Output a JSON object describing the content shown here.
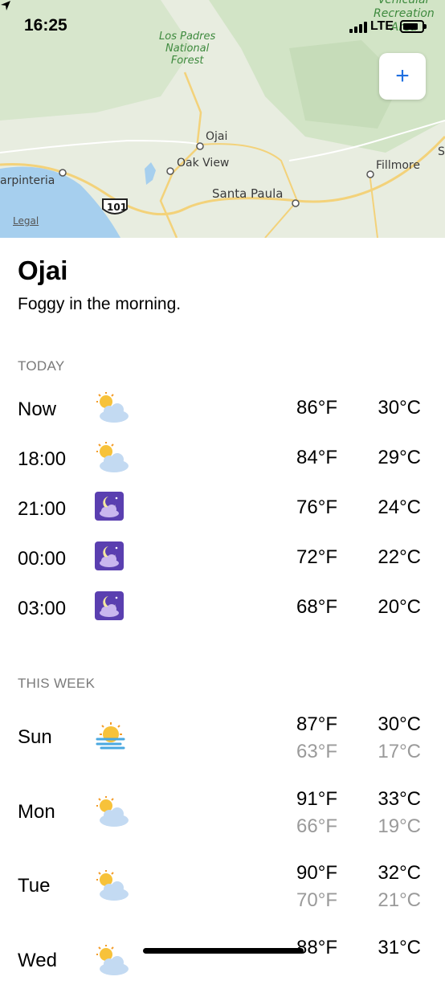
{
  "status_bar": {
    "time": "16:25",
    "network": "LTE",
    "location_icon": "location-arrow-icon"
  },
  "map": {
    "labels": {
      "forest": "Los Padres\nNational\nForest",
      "recreation": "Vehicular\nRecreation\nArea",
      "ojai": "Ojai",
      "oak_view": "Oak View",
      "santa_paula": "Santa Paula",
      "fillmore": "Fillmore",
      "carpinteria": "arpinteria",
      "highway": "101",
      "edge_letter": "S",
      "legal": "Legal"
    },
    "add_button_label": "+"
  },
  "location": {
    "name": "Ojai",
    "summary": "Foggy in the morning."
  },
  "today": {
    "header": "TODAY",
    "rows": [
      {
        "time": "Now",
        "icon": "partly-cloudy-icon",
        "temp_f": "86°F",
        "temp_c": "30°C"
      },
      {
        "time": "18:00",
        "icon": "partly-cloudy-icon",
        "temp_f": "84°F",
        "temp_c": "29°C"
      },
      {
        "time": "21:00",
        "icon": "night-cloud-icon",
        "temp_f": "76°F",
        "temp_c": "24°C"
      },
      {
        "time": "00:00",
        "icon": "night-cloud-icon",
        "temp_f": "72°F",
        "temp_c": "22°C"
      },
      {
        "time": "03:00",
        "icon": "night-cloud-icon",
        "temp_f": "68°F",
        "temp_c": "20°C"
      }
    ]
  },
  "week": {
    "header": "THIS WEEK",
    "rows": [
      {
        "day": "Sun",
        "icon": "sun-fog-icon",
        "high_f": "87°F",
        "low_f": "63°F",
        "high_c": "30°C",
        "low_c": "17°C"
      },
      {
        "day": "Mon",
        "icon": "partly-cloudy-icon",
        "high_f": "91°F",
        "low_f": "66°F",
        "high_c": "33°C",
        "low_c": "19°C"
      },
      {
        "day": "Tue",
        "icon": "partly-cloudy-icon",
        "high_f": "90°F",
        "low_f": "70°F",
        "high_c": "32°C",
        "low_c": "21°C"
      },
      {
        "day": "Wed",
        "icon": "partly-cloudy-icon",
        "high_f": "88°F",
        "high_c": "31°C"
      }
    ]
  },
  "colors": {
    "accent": "#1f6fe0",
    "secondary_text": "#9a9a9a",
    "night_icon_bg": "#5a3fb0"
  }
}
